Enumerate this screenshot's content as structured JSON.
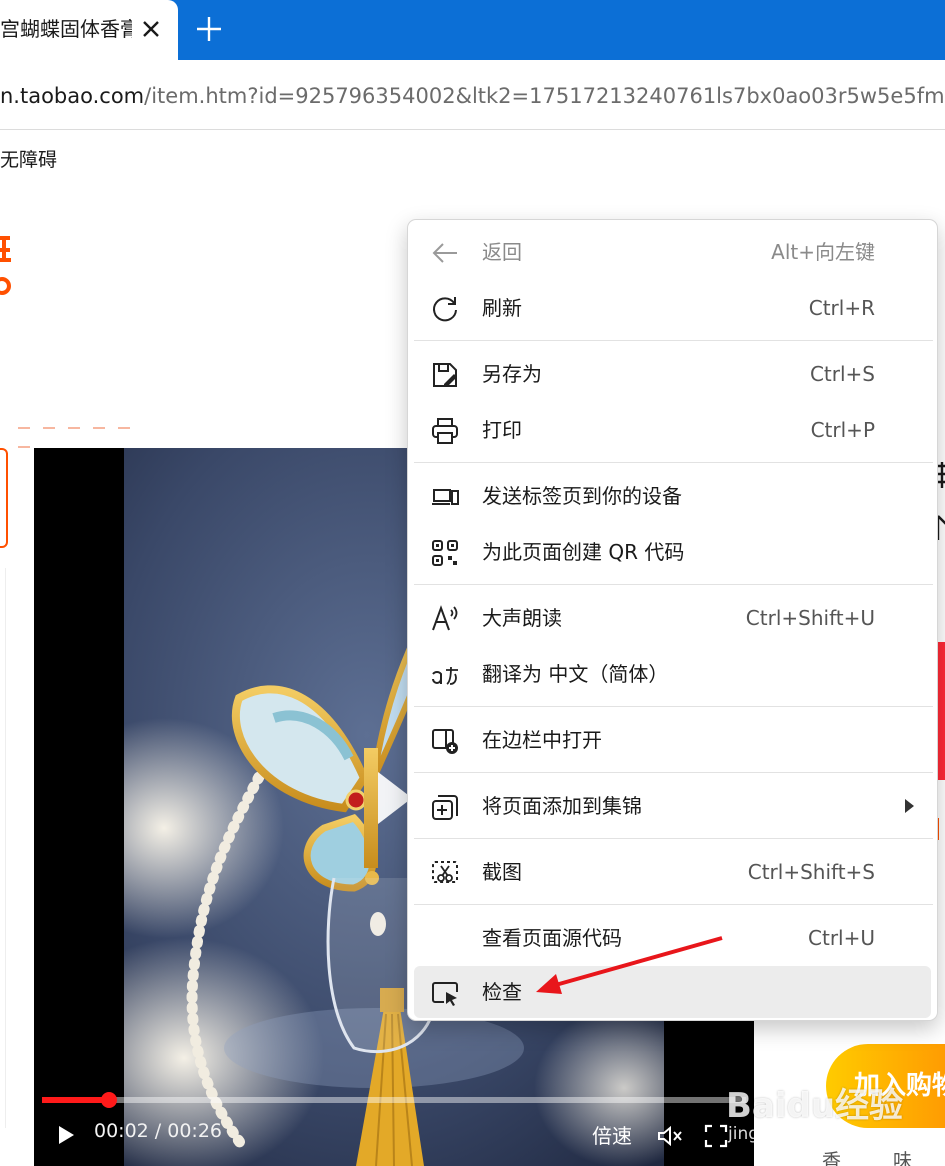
{
  "browser": {
    "tab_title": "宫蝴蝶固体香膏",
    "url_host": "n.taobao.com",
    "url_path": "/item.htm?id=925796354002&ltk2=17517213240761ls7bx0ao03r5w5e5fm",
    "bookmark": "无障碍"
  },
  "video": {
    "time": "00:02 / 00:26",
    "speed_label": "倍速",
    "progress": 0.095
  },
  "page": {
    "cart_label": "加入购物",
    "tags": [
      "香",
      "味"
    ]
  },
  "watermark": {
    "main": "Baidu经验",
    "sub": "jingyan.baidu.com"
  },
  "context_menu": {
    "back": {
      "label": "返回",
      "shortcut": "Alt+向左键"
    },
    "refresh": {
      "label": "刷新",
      "shortcut": "Ctrl+R"
    },
    "save_as": {
      "label": "另存为",
      "shortcut": "Ctrl+S"
    },
    "print": {
      "label": "打印",
      "shortcut": "Ctrl+P"
    },
    "send_tab": {
      "label": "发送标签页到你的设备"
    },
    "qr_code": {
      "label": "为此页面创建 QR 代码"
    },
    "read_aloud": {
      "label": "大声朗读",
      "shortcut": "Ctrl+Shift+U"
    },
    "translate": {
      "label": "翻译为 中文（简体）"
    },
    "sidebar": {
      "label": "在边栏中打开"
    },
    "collections": {
      "label": "将页面添加到集锦"
    },
    "screenshot": {
      "label": "截图",
      "shortcut": "Ctrl+Shift+S"
    },
    "view_source": {
      "label": "查看页面源代码",
      "shortcut": "Ctrl+U"
    },
    "inspect": {
      "label": "检查"
    }
  },
  "colors": {
    "tab_strip": "#0c6fd6",
    "taobao_orange": "#ff5000",
    "scrub_red": "#ff1a1a",
    "annotation_red": "#e8161b",
    "menu_hover": "#ececec"
  }
}
